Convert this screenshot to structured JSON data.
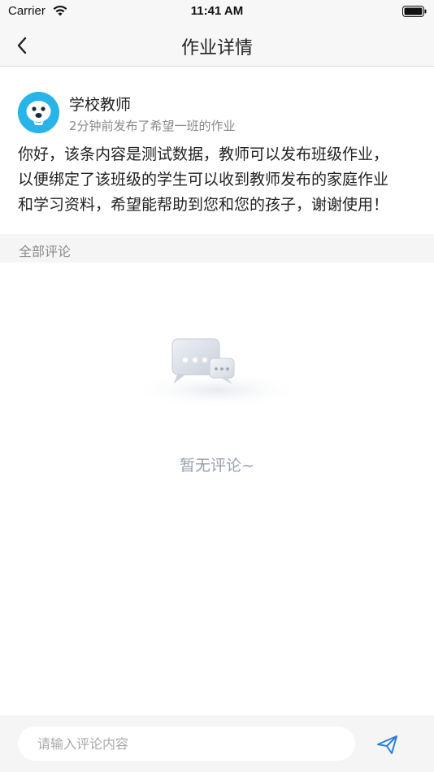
{
  "status_bar": {
    "carrier": "Carrier",
    "time": "11:41 AM"
  },
  "nav": {
    "title": "作业详情",
    "back_icon": "chevron-left-icon"
  },
  "post": {
    "author": "学校教师",
    "meta": "2分钟前发布了希望一班的作业",
    "body_lines": [
      "你好，该条内容是测试数据，教师可以发布班级作业，",
      "以便绑定了该班级的学生可以收到教师发布的家庭作业",
      "和学习资料，希望能帮助到您和您的孩子，谢谢使用！"
    ],
    "avatar_color": "#28b4e8"
  },
  "comments": {
    "header": "全部评论",
    "empty_text": "暂无评论~",
    "empty_icon": "empty-comments-icon"
  },
  "comment_bar": {
    "placeholder": "请输入评论内容",
    "value": "",
    "send_icon": "send-icon",
    "accent": "#2c7fd8"
  }
}
